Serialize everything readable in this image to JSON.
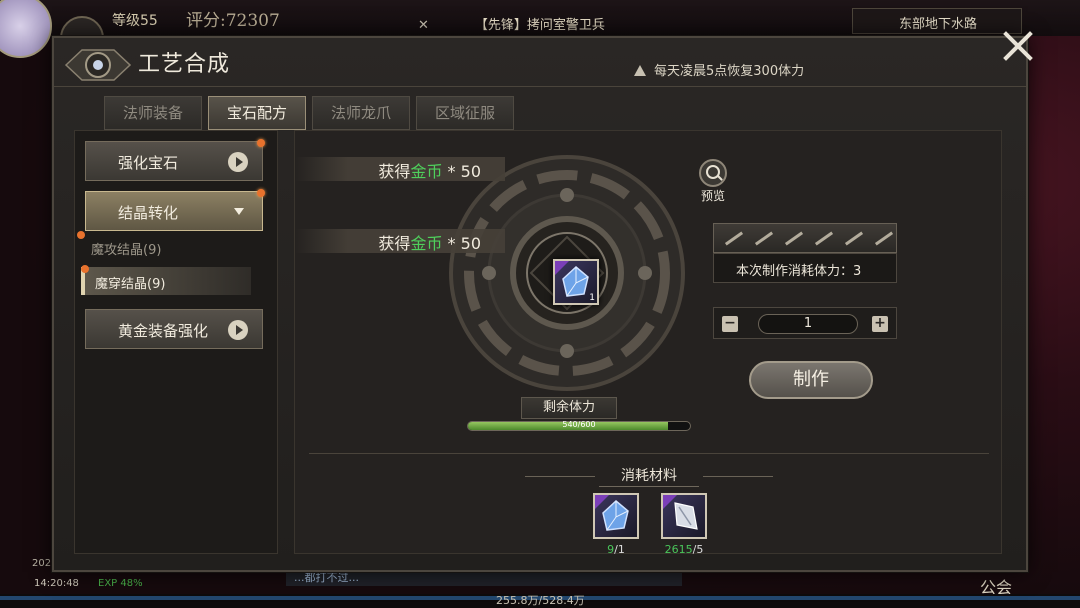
{
  "hud": {
    "level": "等级55",
    "score": "评分:72307",
    "quest": "【先锋】拷问室警卫兵",
    "location": "东部地下水路",
    "time": "14:20:48",
    "exp": "EXP 48%",
    "date": "2025",
    "guild": "公会",
    "exp_numbers": "255.8万/528.4万",
    "chat": "...都打不过..."
  },
  "window": {
    "title": "工艺合成",
    "notice": "每天凌晨5点恢复300体力"
  },
  "tabs": [
    {
      "label": "法师装备",
      "active": false
    },
    {
      "label": "宝石配方",
      "active": true
    },
    {
      "label": "法师龙爪",
      "active": false
    },
    {
      "label": "区域征服",
      "active": false
    }
  ],
  "categories": [
    {
      "label": "强化宝石"
    },
    {
      "label": "结晶转化"
    },
    {
      "label": "黄金装备强化"
    }
  ],
  "subitems": [
    {
      "label": "魔攻结晶(9)"
    },
    {
      "label": "魔穿结晶(9)"
    }
  ],
  "rewards": [
    {
      "prefix": "获得",
      "currency": "金币",
      "amount": "* 50"
    },
    {
      "prefix": "获得",
      "currency": "金币",
      "amount": "* 50"
    }
  ],
  "preview_label": "预览",
  "product": {
    "count": "1",
    "icon": "blue-crystal-icon"
  },
  "cost_label": "本次制作消耗体力：3",
  "quantity": "1",
  "make_label": "制作",
  "stamina": {
    "label": "剩余体力",
    "current": 540,
    "max": 600,
    "text": "540/600"
  },
  "materials": {
    "title": "消耗材料",
    "items": [
      {
        "icon": "blue-crystal-icon",
        "have": "9",
        "need": "/1"
      },
      {
        "icon": "silver-shard-icon",
        "have": "2615",
        "need": "/5"
      }
    ]
  },
  "colors": {
    "gold_text": "#4fd05c",
    "accent": "#e8722d"
  }
}
